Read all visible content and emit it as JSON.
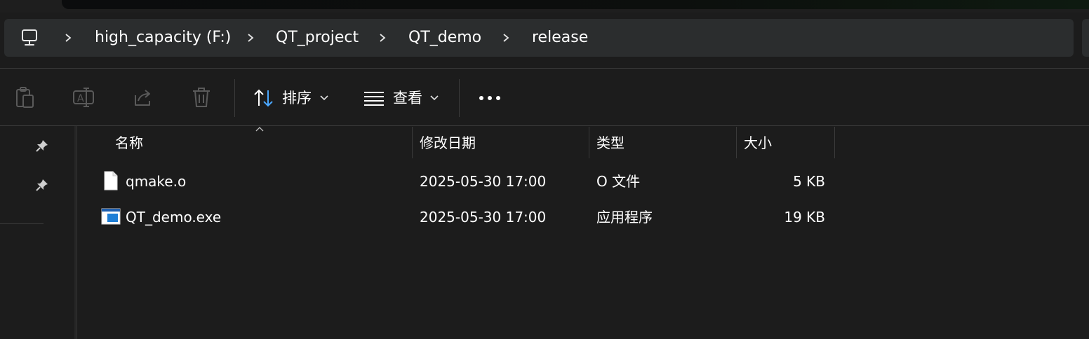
{
  "breadcrumb": {
    "root_icon": "this-pc-icon",
    "items": [
      "high_capacity (F:)",
      "QT_project",
      "QT_demo",
      "release"
    ],
    "separator": ">"
  },
  "toolbar": {
    "paste_icon": "paste-icon",
    "rename_icon": "rename-icon",
    "share_icon": "share-icon",
    "delete_icon": "delete-icon",
    "sort_label": "排序",
    "view_label": "查看",
    "more_label": "···"
  },
  "columns": {
    "name": "名称",
    "date": "修改日期",
    "type": "类型",
    "size": "大小",
    "sort_indicator": "^"
  },
  "files": [
    {
      "name": "qmake.o",
      "date": "2025-05-30 17:00",
      "type": "O 文件",
      "size": "5 KB",
      "icon": "generic-file-icon"
    },
    {
      "name": "QT_demo.exe",
      "date": "2025-05-30 17:00",
      "type": "应用程序",
      "size": "19 KB",
      "icon": "exe-file-icon"
    }
  ],
  "colors": {
    "background": "#1c1c1c",
    "address_bar": "#2b2d2e",
    "accent_blue": "#4aa8ff"
  }
}
